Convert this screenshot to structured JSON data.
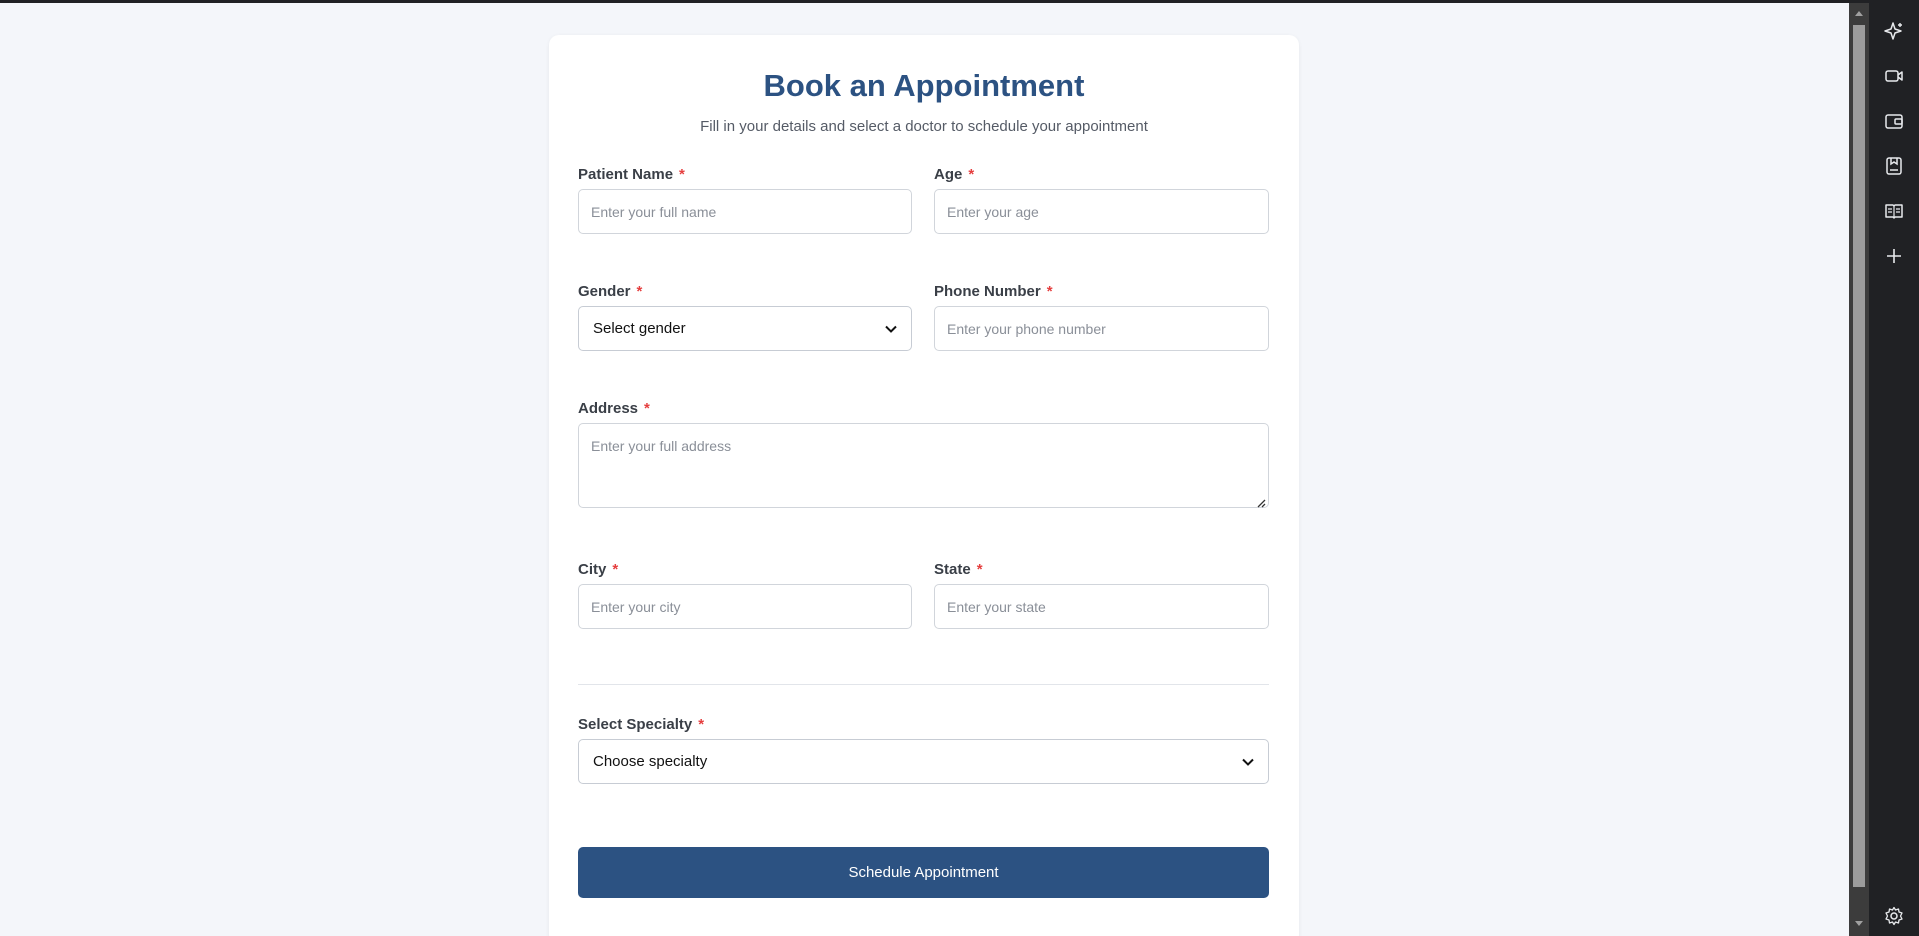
{
  "form": {
    "title": "Book an Appointment",
    "subtitle": "Fill in your details and select a doctor to schedule your appointment",
    "required_marker": "*",
    "fields": {
      "patient_name": {
        "label": "Patient Name",
        "placeholder": "Enter your full name",
        "value": ""
      },
      "age": {
        "label": "Age",
        "placeholder": "Enter your age",
        "value": ""
      },
      "gender": {
        "label": "Gender",
        "selected": "Select gender"
      },
      "phone": {
        "label": "Phone Number",
        "placeholder": "Enter your phone number",
        "value": ""
      },
      "address": {
        "label": "Address",
        "placeholder": "Enter your full address",
        "value": ""
      },
      "city": {
        "label": "City",
        "placeholder": "Enter your city",
        "value": ""
      },
      "state": {
        "label": "State",
        "placeholder": "Enter your state",
        "value": ""
      },
      "specialty": {
        "label": "Select Specialty",
        "selected": "Choose specialty"
      }
    },
    "submit_label": "Schedule Appointment"
  },
  "colors": {
    "accent": "#2c5282",
    "required": "#e53e3e",
    "page_background": "#f4f6fa"
  },
  "side_rail": {
    "icons": [
      "sparkle-icon",
      "video-icon",
      "wallet-icon",
      "save-page-icon",
      "reading-mode-icon",
      "add-icon",
      "settings-icon"
    ]
  }
}
